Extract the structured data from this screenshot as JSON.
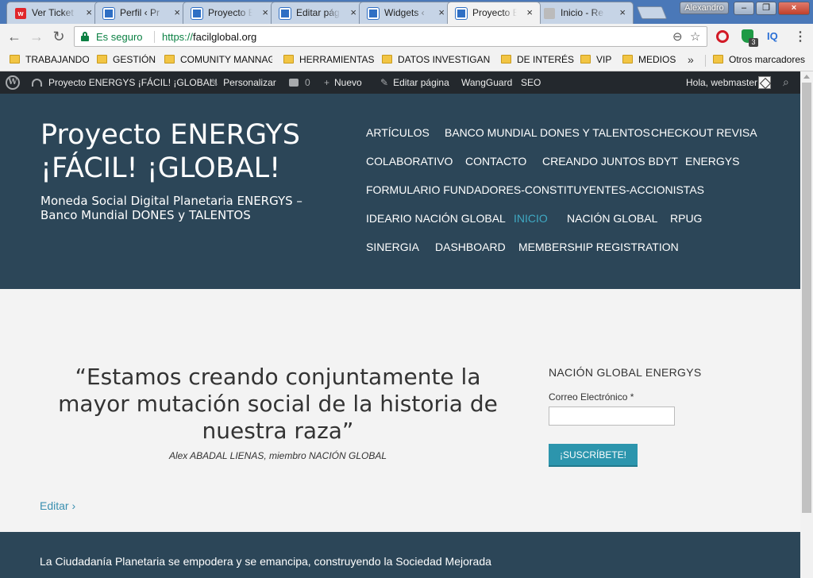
{
  "browser": {
    "tabs": [
      {
        "title": "Ver Ticket",
        "favicon": "ticket-icon",
        "active": false
      },
      {
        "title": "Perfil ‹ Pr",
        "favicon": "wordpress-page-icon",
        "active": false
      },
      {
        "title": "Proyecto E",
        "favicon": "wordpress-page-icon",
        "active": false
      },
      {
        "title": "Editar pág",
        "favicon": "wordpress-page-icon",
        "active": false
      },
      {
        "title": "Widgets ‹",
        "favicon": "wordpress-page-icon",
        "active": false
      },
      {
        "title": "Proyecto E",
        "favicon": "wordpress-page-icon",
        "active": true
      },
      {
        "title": "Inicio - Re",
        "favicon": "avatar-icon",
        "active": false
      }
    ],
    "close_glyph": "×",
    "user_name": "Alexandro",
    "window_controls": {
      "minimize": "–",
      "maximize": "❐",
      "close": "×"
    },
    "toolbar": {
      "back": "←",
      "forward": "→",
      "reload": "↻",
      "secure_label": "Es seguro",
      "url_scheme": "https://",
      "url_host": "facilglobal.org",
      "zoom_icon": "⊖",
      "star_icon": "☆",
      "extension_badge": "3",
      "iq_label": "IQ",
      "menu_icon": "⋮"
    },
    "bookmarks": [
      {
        "label": "TRABAJANDO"
      },
      {
        "label": "GESTIÓN"
      },
      {
        "label": "COMUNITY MANNAGE"
      },
      {
        "label": "HERRAMIENTAS"
      },
      {
        "label": "DATOS INVESTIGANDO"
      },
      {
        "label": "DE INTERÉS"
      },
      {
        "label": "VIP"
      },
      {
        "label": "MEDIOS"
      }
    ],
    "bookmarks_more": "»",
    "other_bookmarks": "Otros marcadores"
  },
  "adminbar": {
    "logo": "W",
    "site_name": "Proyecto ENERGYS ¡FÁCIL! ¡GLOBAL!",
    "customize": "Personalizar",
    "comments_count": "0",
    "new": "Nuevo",
    "edit_page": "Editar página",
    "wangguard": "WangGuard",
    "seo": "SEO",
    "greeting": "Hola, webmaster",
    "search_icon": "⌕"
  },
  "site": {
    "title": "Proyecto ENERGYS ¡FÁCIL! ¡GLOBAL!",
    "description": "Moneda Social Digital Planetaria ENERGYS – Banco Mundial DONES y TALENTOS",
    "menu": [
      {
        "label": "ARTÍCULOS",
        "current": false
      },
      {
        "label": "BANCO MUNDIAL DONES Y TALENTOS",
        "current": false
      },
      {
        "label": "CHECKOUT REVISA",
        "current": false
      },
      {
        "label": "COLABORATIVO",
        "current": false
      },
      {
        "label": "CONTACTO",
        "current": false
      },
      {
        "label": "CREANDO JUNTOS BDYT",
        "current": false
      },
      {
        "label": "ENERGYS",
        "current": false
      },
      {
        "label": "FORMULARIO FUNDADORES-CONSTITUYENTES-ACCIONISTAS",
        "current": false
      },
      {
        "label": "IDEARIO NACIÓN GLOBAL",
        "current": false
      },
      {
        "label": "INICIO",
        "current": true
      },
      {
        "label": "NACIÓN GLOBAL",
        "current": false
      },
      {
        "label": "RPUG",
        "current": false
      },
      {
        "label": "SINERGIA",
        "current": false
      },
      {
        "label": "DASHBOARD",
        "current": false
      },
      {
        "label": "MEMBERSHIP REGISTRATION",
        "current": false
      }
    ],
    "accent_color": "#3fa9c3",
    "header_color": "#2c4658"
  },
  "content": {
    "quote": "“Estamos creando conjuntamente la mayor mutación social de la historia de nuestra raza”",
    "quote_author": "Alex ABADAL LIENAS, miembro NACIÓN GLOBAL",
    "edit_link": "Editar ›"
  },
  "widget": {
    "title": "NACIÓN GLOBAL ENERGYS",
    "email_label": "Correo Electrónico *",
    "email_value": "",
    "subscribe_button": "¡SUSCRÍBETE!"
  },
  "footer": {
    "text": "La Ciudadanía Planetaria se empodera y se emancipa, construyendo la Sociedad Mejorada"
  }
}
